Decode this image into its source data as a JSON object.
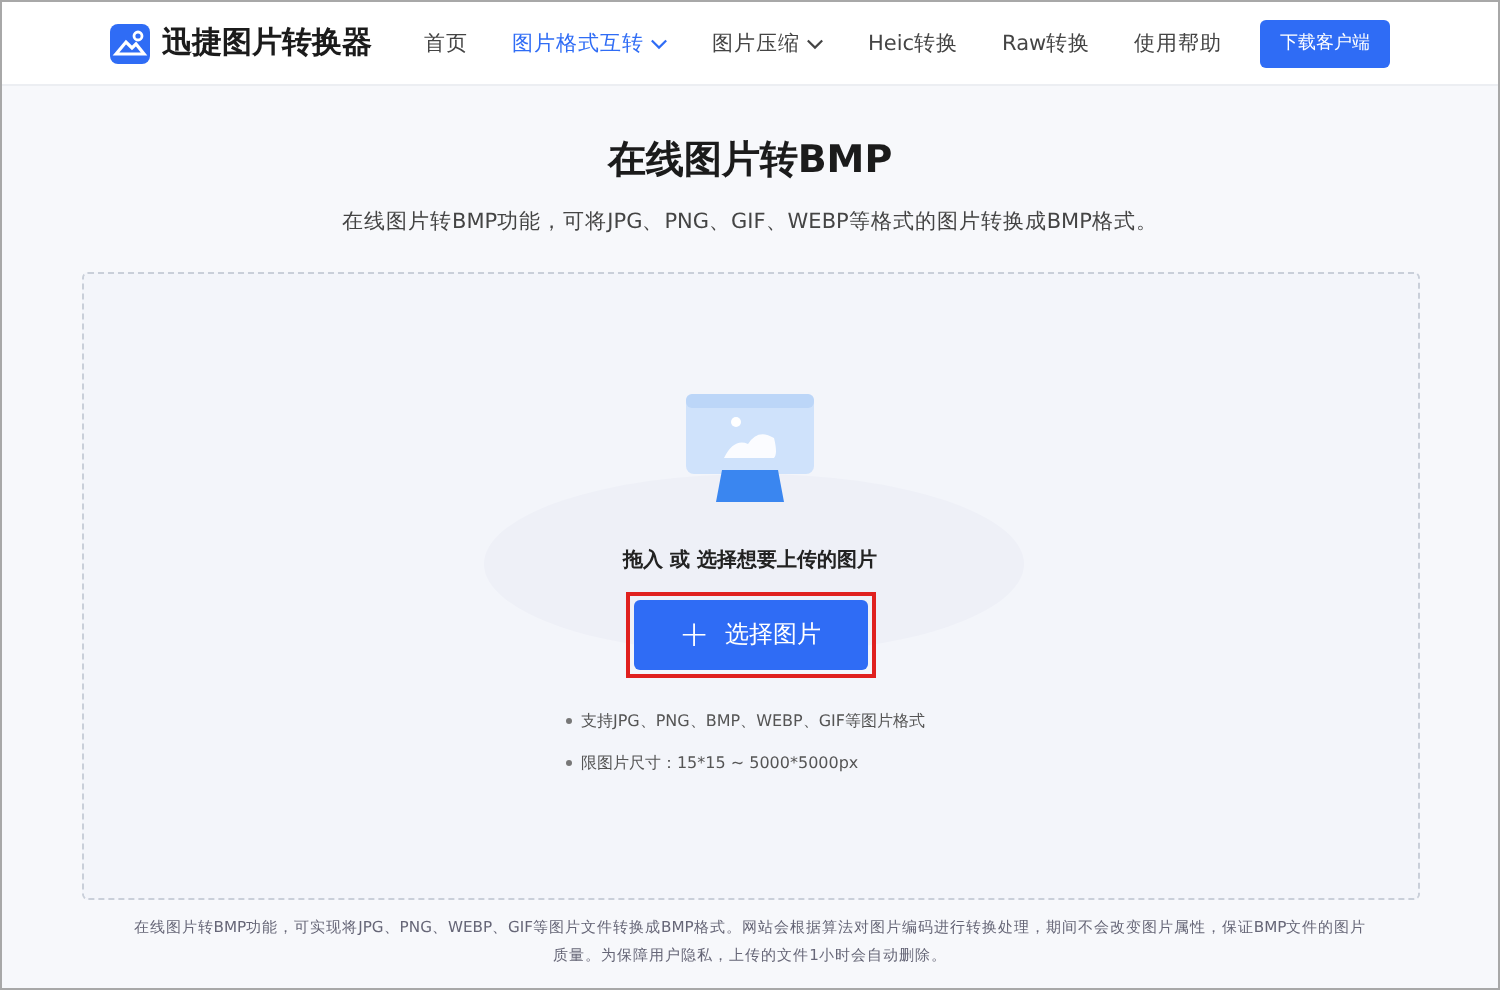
{
  "header": {
    "logo_text": "迅捷图片转换器",
    "nav": [
      {
        "label": "首页",
        "selected": false,
        "dropdown": false
      },
      {
        "label": "图片格式互转",
        "selected": true,
        "dropdown": true
      },
      {
        "label": "图片压缩",
        "selected": false,
        "dropdown": true
      },
      {
        "label": "Heic转换",
        "selected": false,
        "dropdown": false
      },
      {
        "label": "Raw转换",
        "selected": false,
        "dropdown": false
      },
      {
        "label": "使用帮助",
        "selected": false,
        "dropdown": false
      }
    ],
    "download_button": "下载客户端"
  },
  "title": "在线图片转BMP",
  "subtitle": "在线图片转BMP功能，可将JPG、PNG、GIF、WEBP等格式的图片转换成BMP格式。",
  "upload": {
    "prompt": "拖入 或 选择想要上传的图片",
    "button": {
      "icon": "+",
      "label": "选择图片",
      "highlighted": true
    },
    "notes": [
      "支持JPG、PNG、BMP、WEBP、GIF等图片格式",
      "限图片尺寸：15*15 ~ 5000*5000px"
    ]
  },
  "footer_text": "在线图片转BMP功能，可实现将JPG、PNG、WEBP、GIF等图片文件转换成BMP格式。网站会根据算法对图片编码进行转换处理，期间不会改变图片属性，保证BMP文件的图片质量。为保障用户隐私，上传的文件1小时会自动删除。"
}
